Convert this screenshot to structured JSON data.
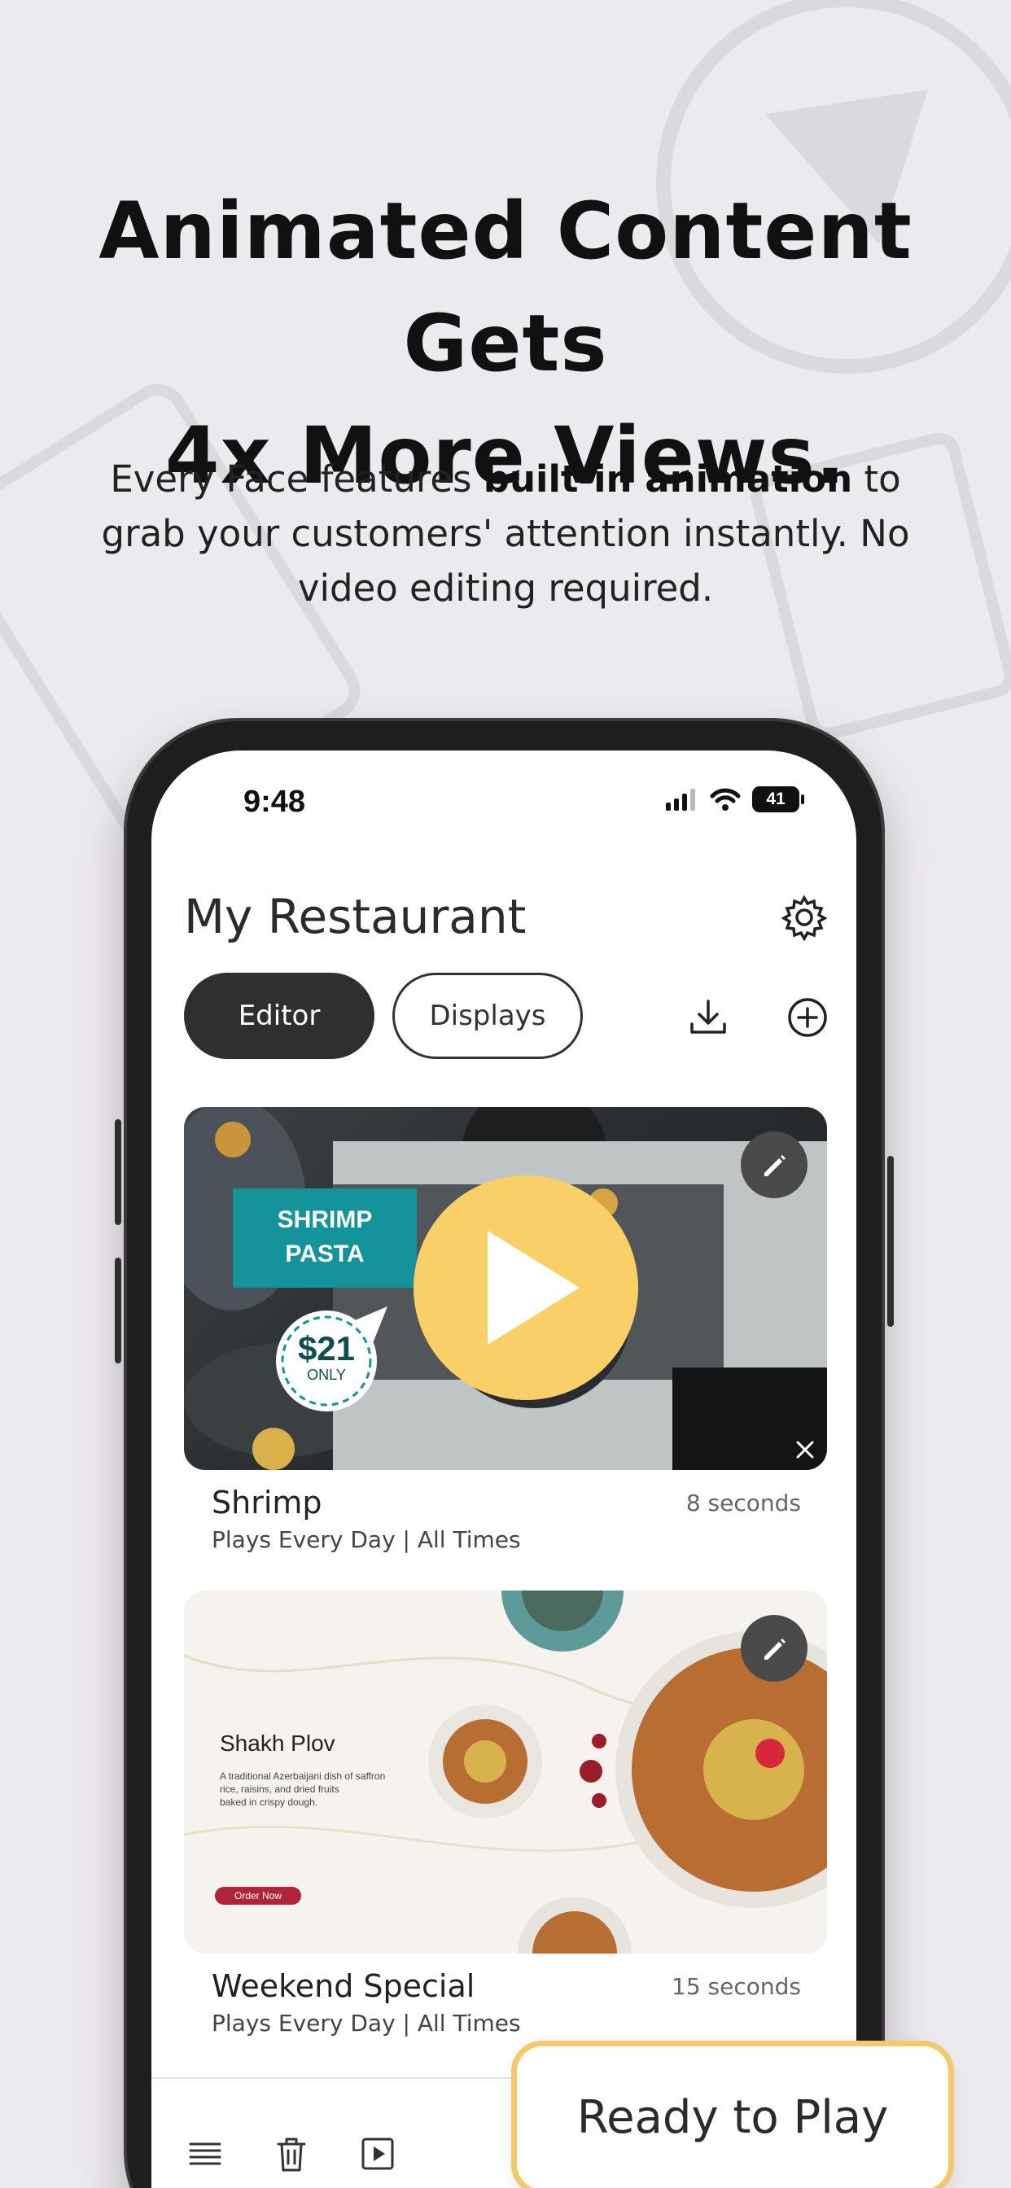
{
  "hero": {
    "headline_line1": "Animated Content Gets",
    "headline_line2": "4x More Views.",
    "sub_pre": "Every Face features ",
    "sub_bold": "built-in animation",
    "sub_post": " to grab your customers' attention instantly. No video editing required."
  },
  "status_bar": {
    "time": "9:48",
    "battery": "41"
  },
  "app": {
    "title": "My Restaurant",
    "tabs": {
      "editor": "Editor",
      "displays": "Displays"
    }
  },
  "items": [
    {
      "name": "Shrimp",
      "schedule": "Plays Every Day | All Times",
      "duration": "8 seconds",
      "preview": {
        "banner_line1": "SHRIMP",
        "banner_line2": "PASTA",
        "price": "$21",
        "price_note": "ONLY"
      }
    },
    {
      "name": "Weekend Special",
      "schedule": "Plays Every Day | All Times",
      "duration": "15 seconds",
      "preview": {
        "dish_title": "Shakh Plov",
        "desc_line1": "A traditional Azerbaijani dish of saffron",
        "desc_line2": "rice, raisins, and dried fruits",
        "desc_line3": "baked in crispy dough.",
        "cta": "Order Now"
      }
    }
  ],
  "ready_button": "Ready to Play",
  "colors": {
    "accent_yellow": "#f9d068",
    "teal_banner": "#14939b",
    "dark_tab": "#2f2f2f",
    "cta_red": "#b0243a"
  },
  "icons": [
    "gear-icon",
    "download-icon",
    "add-circle-icon",
    "edit-pencil-icon",
    "play-icon",
    "list-icon",
    "trash-icon",
    "play-square-icon",
    "shuffle-icon"
  ]
}
